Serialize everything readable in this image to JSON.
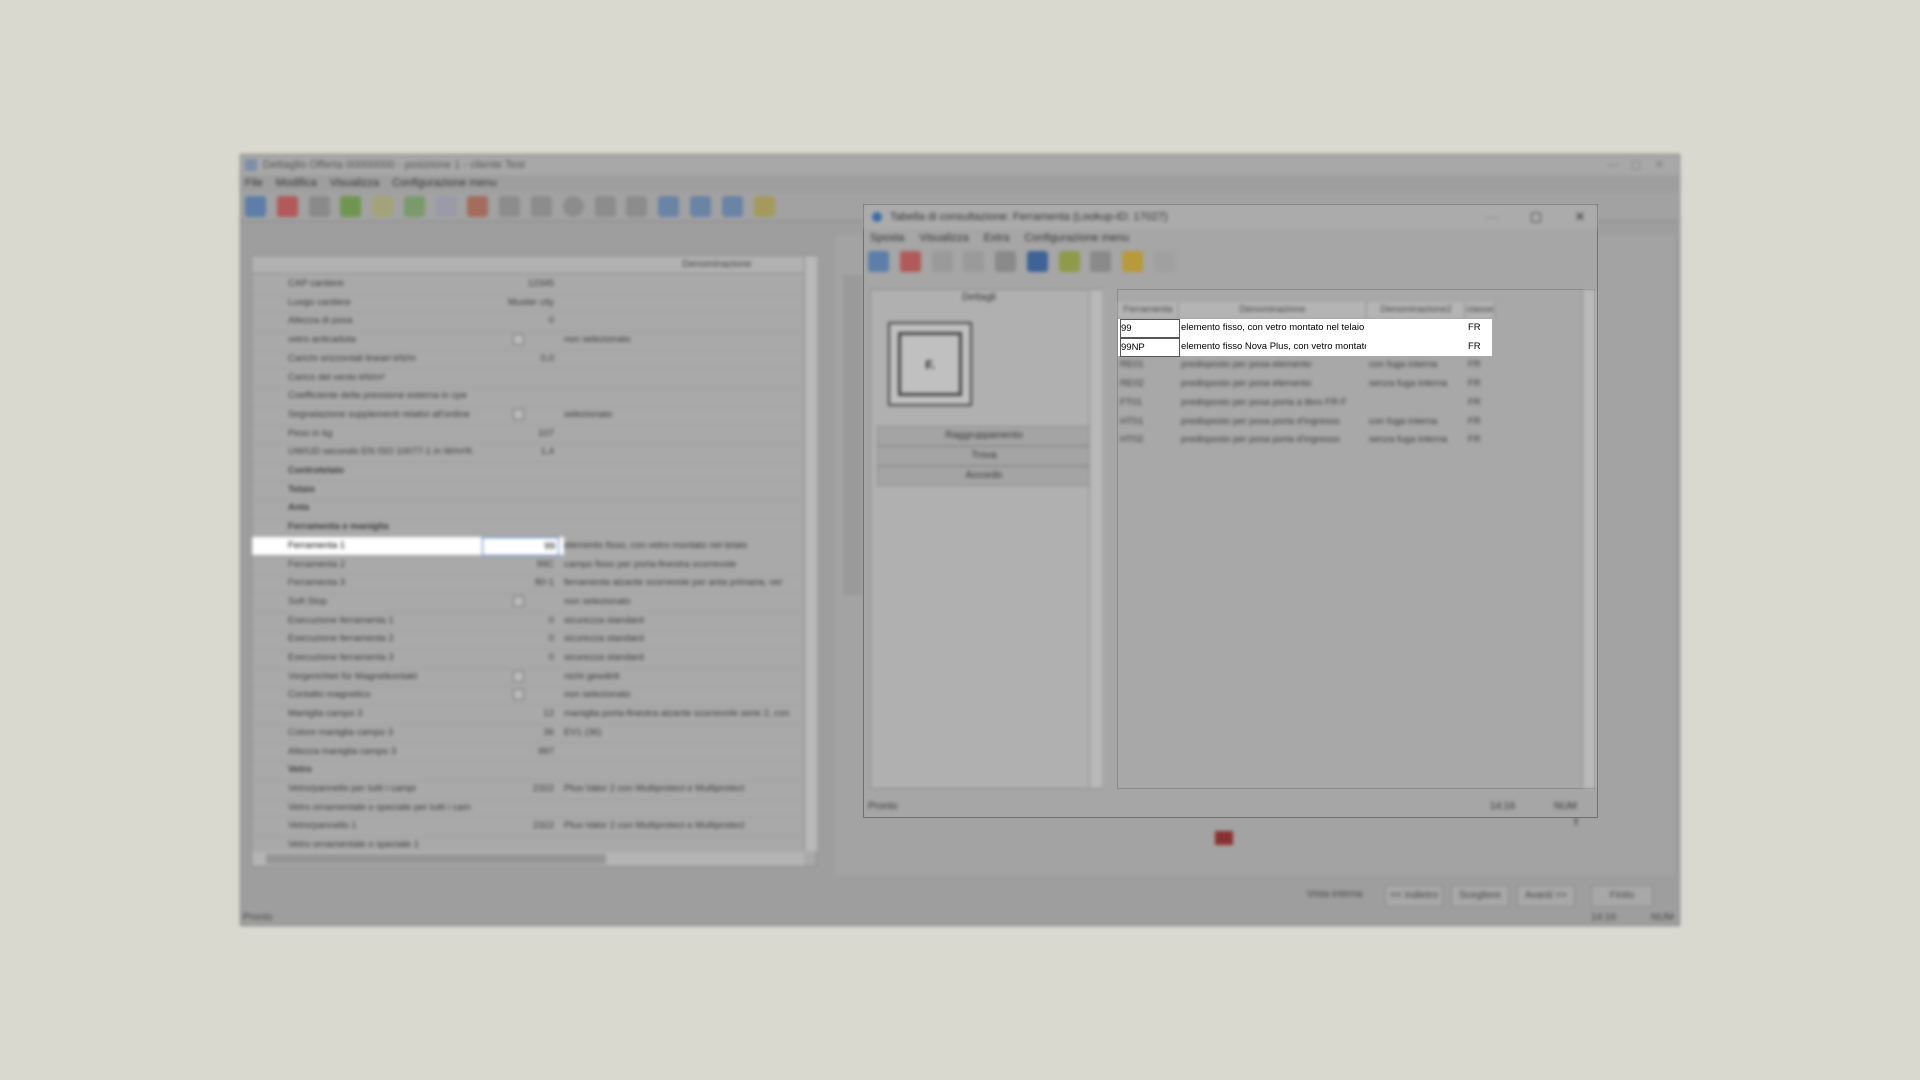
{
  "main": {
    "title": "Dettaglio Offerta 00000000 - posizione 1 - cliente Test",
    "menu": [
      "File",
      "Modifica",
      "Visualizza",
      "Configurazione menu"
    ],
    "columns": {
      "value": "",
      "denominazione": "Denominazione"
    },
    "rows": [
      {
        "label": "CAP cantiere",
        "value": "12345",
        "desc": ""
      },
      {
        "label": "Luogo cantiere",
        "value": "Muster city",
        "desc": ""
      },
      {
        "label": "Altezza di posa",
        "value": "0",
        "desc": ""
      },
      {
        "label": "vetro anticaduta",
        "value": "",
        "desc": "non selezionato",
        "check": true
      },
      {
        "label": "Carichi orizzontali lineari kN/m",
        "value": "0,0",
        "desc": ""
      },
      {
        "label": "Carico del vento kN/m²",
        "value": "",
        "desc": ""
      },
      {
        "label": "Coefficiente della pressione esterna in cpe",
        "value": "",
        "desc": ""
      },
      {
        "label": "Segnalazione supplementi relativi all'ordine",
        "value": "",
        "desc": "selezionato",
        "check": true
      },
      {
        "label": "Peso in kg",
        "value": "107",
        "desc": ""
      },
      {
        "label": "UW/UD secondo EN ISO 10077-1 in W/m²K",
        "value": "1,4",
        "desc": ""
      },
      {
        "label": "Controtelaio",
        "value": "",
        "desc": "",
        "group": true
      },
      {
        "label": "Telaio",
        "value": "",
        "desc": "",
        "group": true
      },
      {
        "label": "Anta",
        "value": "",
        "desc": "",
        "group": true
      },
      {
        "label": "Ferramenta e maniglia",
        "value": "",
        "desc": "",
        "group": true
      },
      {
        "label": "Ferramenta 1",
        "value": "99",
        "desc": "elemento fisso, con vetro montato nel telaio",
        "highlight": true
      },
      {
        "label": "Ferramenta 2",
        "value": "99C",
        "desc": "campo fisso per porta-finestra scorrevole"
      },
      {
        "label": "Ferramenta 3",
        "value": "80-1",
        "desc": "ferramenta alzante scorrevole per anta primaria, ver"
      },
      {
        "label": "Soft Stop",
        "value": "",
        "desc": "non selezionato",
        "check": true
      },
      {
        "label": "Esecuzione ferramenta 1",
        "value": "0",
        "desc": "sicurezza standard"
      },
      {
        "label": "Esecuzione ferramenta 2",
        "value": "0",
        "desc": "sicurezza standard"
      },
      {
        "label": "Esecuzione ferramenta 3",
        "value": "0",
        "desc": "sicurezza standard"
      },
      {
        "label": "Vorgerichtet für Magnetkontakt",
        "value": "",
        "desc": "nicht gewählt",
        "check": true
      },
      {
        "label": "Contatto magnetico",
        "value": "",
        "desc": "non selezionato",
        "check": true
      },
      {
        "label": "Maniglia campo 3",
        "value": "12",
        "desc": "maniglia porta-finestra alzante scorrevole serie 2, con"
      },
      {
        "label": "Colore maniglia campo 3",
        "value": "36",
        "desc": "EV1 (36)"
      },
      {
        "label": "Altezza maniglia campo 3",
        "value": "997",
        "desc": ""
      },
      {
        "label": "Vetro",
        "value": "",
        "desc": "",
        "group": true
      },
      {
        "label": "Vetro/pannello per tutti i campi",
        "value": "2322",
        "desc": "Plus-Valor 2 con Multiprotect e Multiprotect"
      },
      {
        "label": "Vetro ornamentale o speciale per tutti i cam",
        "value": "",
        "desc": ""
      },
      {
        "label": "Vetro/pannello 1",
        "value": "2322",
        "desc": "Plus-Valor 2 con Multiprotect e Multiprotect"
      },
      {
        "label": "Vetro ornamentale o speciale 1",
        "value": "",
        "desc": ""
      }
    ],
    "bottom_buttons": [
      "Vista interna",
      "<< Indietro",
      "Scegliere",
      "Avanti >>",
      "Finito"
    ],
    "status_left": "Pronto",
    "status_time": "14:16",
    "status_num": "NUM"
  },
  "dialog": {
    "title": "Tabella di consultazione: Ferramenta (Lookup-ID: 17027)",
    "menu": [
      "Sposta",
      "Visualizza",
      "Extra",
      "Configurazione menu"
    ],
    "details_label": "Dettagli",
    "preview_label": "F.",
    "accordions": [
      "Raggruppamento",
      "Trova",
      "Accordo"
    ],
    "columns": [
      "Ferramenta",
      "Denominazione",
      "Denominazione2",
      "classe"
    ],
    "rows": [
      {
        "code": "99",
        "name": "elemento fisso, con vetro montato nel telaio",
        "name2": "",
        "cls": "FR",
        "selected": true
      },
      {
        "code": "99NP",
        "name": "elemento fisso Nova Plus, con vetro montato",
        "name2": "",
        "cls": "FR",
        "selected": true
      },
      {
        "code": "RE01",
        "name": "predisposto per posa elemento",
        "name2": "con fuga interna",
        "cls": "FR"
      },
      {
        "code": "RE02",
        "name": "predisposto per posa elemento",
        "name2": "senza fuga interna",
        "cls": "FR"
      },
      {
        "code": "FT01",
        "name": "predisposto per posa porta a libro FR-F",
        "name2": "",
        "cls": "FR"
      },
      {
        "code": "HT01",
        "name": "predisposto per posa porta d'ingresso",
        "name2": "con fuga interna",
        "cls": "FR"
      },
      {
        "code": "HT02",
        "name": "predisposto per posa porta d'ingresso",
        "name2": "senza fuga interna",
        "cls": "FR"
      }
    ],
    "status_left": "Pronto",
    "status_time": "14:16",
    "status_num": "NUM"
  },
  "colors": {
    "accent": "#4a7abf",
    "selection": "#ffffff",
    "overlay": "#9e9e9e"
  }
}
